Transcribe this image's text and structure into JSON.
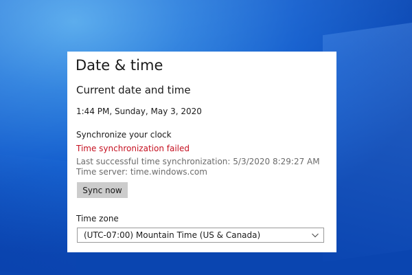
{
  "panel": {
    "title": "Date & time",
    "section_title": "Current date and time",
    "current_datetime": "1:44 PM, Sunday, May 3, 2020"
  },
  "sync": {
    "heading": "Synchronize your clock",
    "status": "Time synchronization failed",
    "last_success": "Last successful time synchronization: 5/3/2020 8:29:27 AM",
    "server": "Time server: time.windows.com",
    "button_label": "Sync now"
  },
  "time_zone": {
    "label": "Time zone",
    "selected": "(UTC-07:00) Mountain Time (US & Canada)",
    "icon": "chevron-down-icon"
  },
  "colors": {
    "error_text": "#c50f1f",
    "secondary_text": "#6b6b6b",
    "button_bg": "#cccccc",
    "desktop_blue": "#1560cf"
  }
}
